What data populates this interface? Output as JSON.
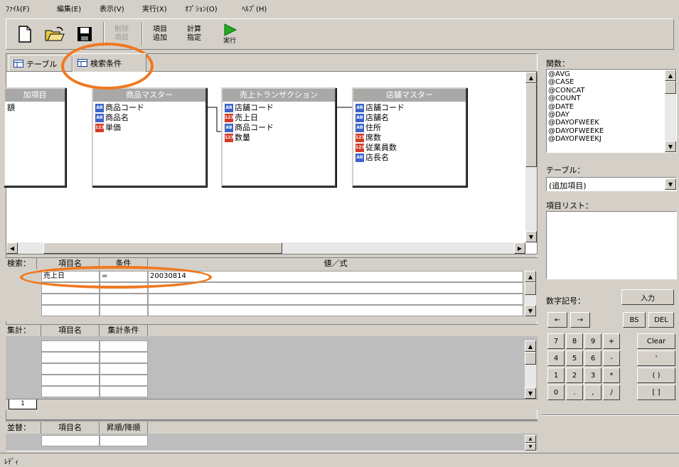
{
  "menu": [
    "ﾌｧｲﾙ(F)",
    "編集(E)",
    "表示(V)",
    "実行(X)",
    "ｵﾌﾟｼｮﾝ(O)",
    "ﾍﾙﾌﾟ(H)"
  ],
  "toolbar": {
    "new_icon": "new-file-icon",
    "open_icon": "open-folder-icon",
    "save_icon": "save-icon",
    "delete_label": "削除\n項目",
    "add_label": "項目\n追加",
    "calc_label": "計算\n指定",
    "run_label": "実行",
    "run_color": "#22aa22"
  },
  "tabs": [
    {
      "label": "テーブル"
    },
    {
      "label": "検索条件"
    }
  ],
  "diagram": {
    "tables": [
      {
        "title": "加項目",
        "fields": [
          {
            "icon": "",
            "name": "額"
          }
        ]
      },
      {
        "title": "商品マスター",
        "fields": [
          {
            "icon": "AB",
            "name": "商品コード"
          },
          {
            "icon": "AB",
            "name": "商品名"
          },
          {
            "icon": "123",
            "name": "単価"
          }
        ]
      },
      {
        "title": "売上トランザクション",
        "fields": [
          {
            "icon": "AB",
            "name": "店舗コード"
          },
          {
            "icon": "123",
            "name": "売上日"
          },
          {
            "icon": "AB",
            "name": "商品コード"
          },
          {
            "icon": "123",
            "name": "数量"
          }
        ]
      },
      {
        "title": "店舗マスター",
        "fields": [
          {
            "icon": "AB",
            "name": "店舗コード"
          },
          {
            "icon": "AB",
            "name": "店舗名"
          },
          {
            "icon": "AB",
            "name": "住所"
          },
          {
            "icon": "123",
            "name": "席数"
          },
          {
            "icon": "123",
            "name": "従業員数"
          },
          {
            "icon": "AB",
            "name": "店長名"
          }
        ]
      }
    ]
  },
  "search": {
    "label": "検索：",
    "headers": [
      "項目名",
      "条件",
      "値／式"
    ],
    "rows": [
      {
        "item": "売上日",
        "cond": "=",
        "value": "20030814"
      }
    ]
  },
  "aggregate": {
    "label": "集計：",
    "headers": [
      "項目名",
      "集計条件"
    ],
    "tab": "1"
  },
  "sort": {
    "label": "並替：",
    "headers": [
      "項目名",
      "昇順/降順"
    ]
  },
  "right": {
    "functions_label": "関数：",
    "functions": [
      "@AVG",
      "@CASE",
      "@CONCAT",
      "@COUNT",
      "@DATE",
      "@DAY",
      "@DAYOFWEEK",
      "@DAYOFWEEKE",
      "@DAYOFWEEKJ"
    ],
    "table_label": "テーブル：",
    "table_value": "(追加項目)",
    "items_label": "項目リスト：",
    "numsym_label": "数字記号：",
    "input_button": "入力",
    "left_arrow": "←",
    "right_arrow": "→",
    "bs": "BS",
    "del": "DEL",
    "keys": [
      [
        "7",
        "8",
        "9",
        "+"
      ],
      [
        "4",
        "5",
        "6",
        "-"
      ],
      [
        "1",
        "2",
        "3",
        "*"
      ],
      [
        "0",
        ".",
        ",",
        "/"
      ]
    ],
    "clear": "Clear",
    "quote": "'",
    "paren": "(   )",
    "bracket": "[   ]"
  },
  "status": "ﾚﾃﾞｨ",
  "highlight_color": "#f07820"
}
